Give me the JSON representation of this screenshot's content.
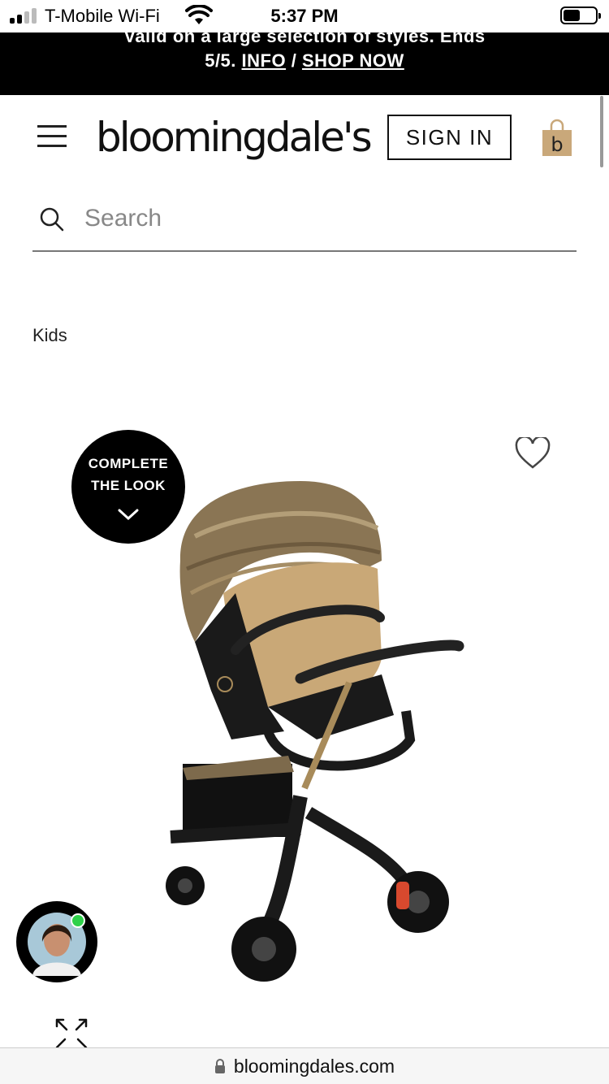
{
  "status_bar": {
    "carrier": "T-Mobile Wi-Fi",
    "time": "5:37 PM"
  },
  "promo": {
    "line1": "Valid on a large selection of styles. Ends",
    "line2_prefix": "5/5.",
    "info_link": "INFO",
    "separator": "/",
    "shop_link": "SHOP NOW"
  },
  "header": {
    "logo": "bloomingdale's",
    "sign_in": "SIGN IN",
    "bag_letter": "b"
  },
  "search": {
    "placeholder": "Search"
  },
  "breadcrumb": "Kids",
  "product": {
    "complete_look_line1": "COMPLETE",
    "complete_look_line2": "THE LOOK"
  },
  "address_bar": {
    "url": "bloomingdales.com"
  },
  "colors": {
    "banner_bg": "#000000",
    "bag": "#c9a87a",
    "online": "#2ed14a"
  }
}
